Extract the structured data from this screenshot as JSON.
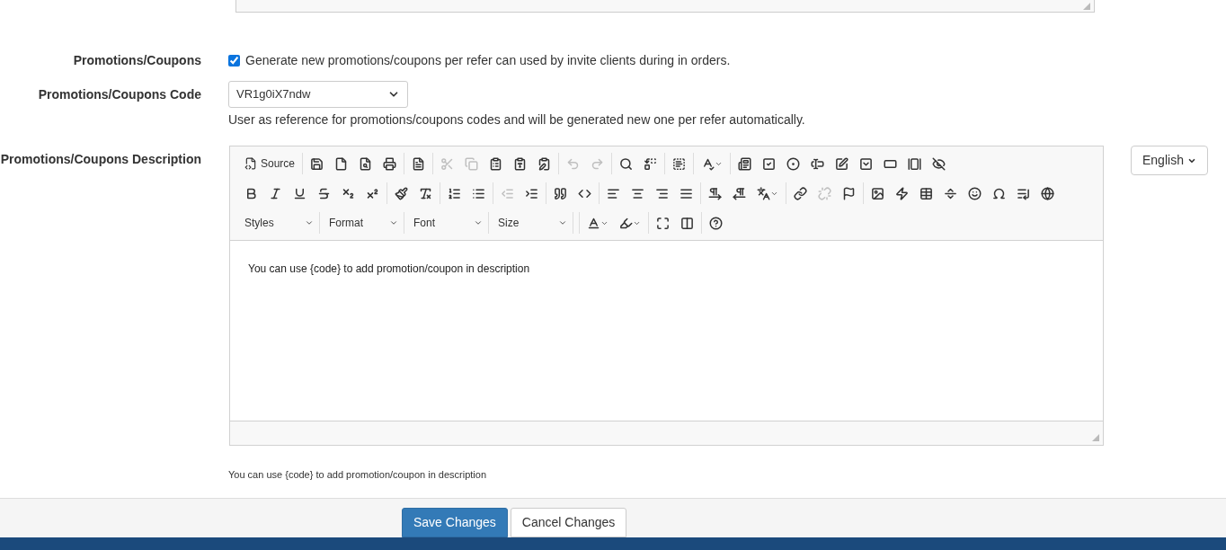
{
  "fields": [
    {
      "kind": "checkbox",
      "label": "Promotions/Coupons",
      "checked": true,
      "text": "Generate new promotions/coupons per refer can used by invite clients during in orders."
    },
    {
      "kind": "select",
      "label": "Promotions/Coupons Code",
      "value": "VR1g0iX7ndw",
      "help": "User as reference for promotions/coupons codes and will be generated new one per refer automatically."
    }
  ],
  "description": {
    "label": "Promotions/Coupons Description",
    "language": "English",
    "toolbar": [
      [
        [
          {
            "kind": "source",
            "label": "Source",
            "disabled": false
          }
        ],
        [
          {
            "kind": "save",
            "disabled": false
          },
          {
            "kind": "newpage",
            "disabled": false
          },
          {
            "kind": "preview",
            "disabled": false
          },
          {
            "kind": "print",
            "disabled": false
          }
        ],
        [
          {
            "kind": "templates",
            "disabled": false
          }
        ],
        [
          {
            "kind": "cut",
            "disabled": true
          },
          {
            "kind": "copy",
            "disabled": true
          },
          {
            "kind": "paste",
            "disabled": false
          },
          {
            "kind": "pastetext",
            "disabled": false
          },
          {
            "kind": "pasteword",
            "disabled": false
          }
        ],
        [
          {
            "kind": "undo",
            "disabled": true
          },
          {
            "kind": "redo",
            "disabled": true
          }
        ],
        [
          {
            "kind": "find",
            "disabled": false
          },
          {
            "kind": "replace",
            "disabled": false
          }
        ],
        [
          {
            "kind": "selectall",
            "disabled": false
          }
        ],
        [
          {
            "kind": "spellcheck",
            "disabled": false
          }
        ],
        [
          {
            "kind": "form",
            "disabled": false
          },
          {
            "kind": "checkbox",
            "disabled": false
          },
          {
            "kind": "radio",
            "disabled": false
          },
          {
            "kind": "textfield",
            "disabled": false
          },
          {
            "kind": "textarea",
            "disabled": false
          },
          {
            "kind": "select",
            "disabled": false
          },
          {
            "kind": "button",
            "disabled": false
          },
          {
            "kind": "imagebutton",
            "disabled": false
          },
          {
            "kind": "hiddenfield",
            "disabled": false
          }
        ]
      ],
      [
        [
          {
            "kind": "bold",
            "disabled": false
          },
          {
            "kind": "italic",
            "disabled": false
          },
          {
            "kind": "underline",
            "disabled": false
          },
          {
            "kind": "strike",
            "disabled": false
          },
          {
            "kind": "subscript",
            "disabled": false
          },
          {
            "kind": "superscript",
            "disabled": false
          }
        ],
        [
          {
            "kind": "copyformat",
            "disabled": false
          },
          {
            "kind": "removeformat",
            "disabled": false
          }
        ],
        [
          {
            "kind": "numberedlist",
            "disabled": false
          },
          {
            "kind": "bulletedlist",
            "disabled": false
          }
        ],
        [
          {
            "kind": "outdent",
            "disabled": true
          },
          {
            "kind": "indent",
            "disabled": false
          }
        ],
        [
          {
            "kind": "blockquote",
            "disabled": false
          },
          {
            "kind": "creatediv",
            "disabled": false
          }
        ],
        [
          {
            "kind": "alignleft",
            "disabled": false
          },
          {
            "kind": "aligncenter",
            "disabled": false
          },
          {
            "kind": "alignright",
            "disabled": false
          },
          {
            "kind": "justify",
            "disabled": false
          }
        ],
        [
          {
            "kind": "ltr",
            "disabled": false
          },
          {
            "kind": "rtl",
            "disabled": false
          },
          {
            "kind": "language",
            "disabled": false
          }
        ],
        [
          {
            "kind": "link",
            "disabled": false
          },
          {
            "kind": "unlink",
            "disabled": true
          },
          {
            "kind": "anchor",
            "disabled": false
          }
        ],
        [
          {
            "kind": "image",
            "disabled": false
          },
          {
            "kind": "flash",
            "disabled": false
          },
          {
            "kind": "table",
            "disabled": false
          },
          {
            "kind": "hr",
            "disabled": false
          },
          {
            "kind": "smiley",
            "disabled": false
          },
          {
            "kind": "specialchar",
            "disabled": false
          },
          {
            "kind": "pagebreak",
            "disabled": false
          },
          {
            "kind": "iframe",
            "disabled": false
          }
        ]
      ],
      [
        [
          {
            "kind": "combo",
            "label": "Styles",
            "disabled": false
          },
          {
            "kind": "combo",
            "label": "Format",
            "disabled": false
          },
          {
            "kind": "combo",
            "label": "Font",
            "disabled": false
          },
          {
            "kind": "combo",
            "label": "Size",
            "disabled": false
          }
        ],
        [
          {
            "kind": "textcolor",
            "disabled": false
          },
          {
            "kind": "bgcolor",
            "disabled": false
          }
        ],
        [
          {
            "kind": "maximize",
            "disabled": false
          },
          {
            "kind": "showblocks",
            "disabled": false
          }
        ],
        [
          {
            "kind": "about",
            "disabled": false
          }
        ]
      ]
    ],
    "content": "You can use {code} to add promotion/coupon in description",
    "note": "You can use {code} to add promotion/coupon in description"
  },
  "buttons": [
    {
      "kind": "primary",
      "label": "Save Changes"
    },
    {
      "kind": "default",
      "label": "Cancel Changes"
    }
  ]
}
